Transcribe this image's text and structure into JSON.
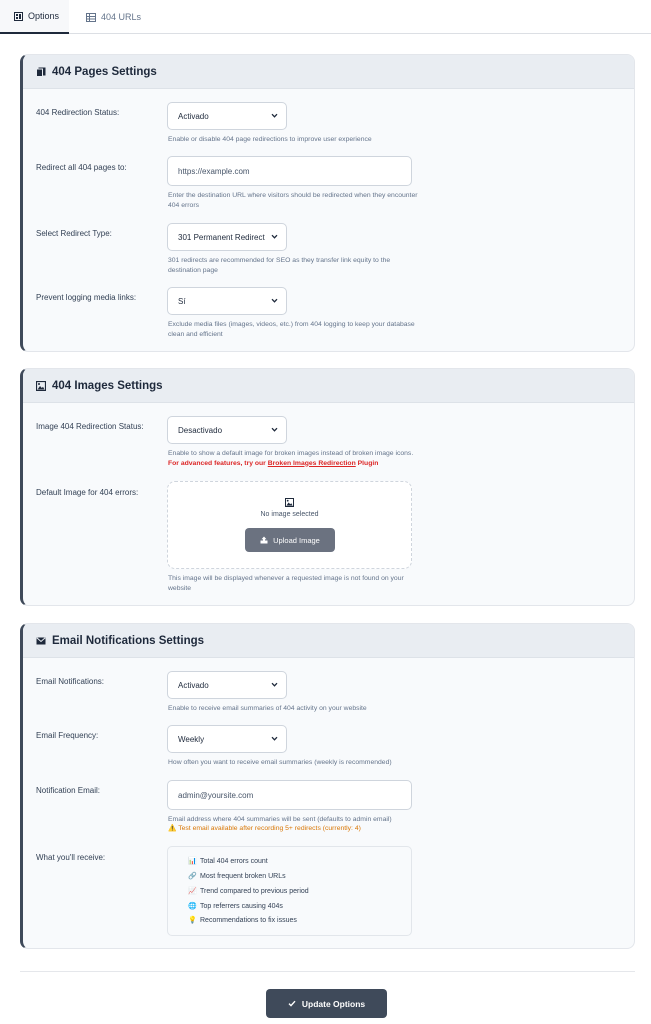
{
  "tabs": [
    {
      "label": "Options",
      "icon": "grid-icon",
      "active": true
    },
    {
      "label": "404 URLs",
      "icon": "table-icon",
      "active": false
    }
  ],
  "pages_section": {
    "title": "404 Pages Settings",
    "icon": "document-icon",
    "redirection_status": {
      "label": "404 Redirection Status:",
      "value": "Activado",
      "help": "Enable or disable 404 page redirections to improve user experience"
    },
    "redirect_to": {
      "label": "Redirect all 404 pages to:",
      "placeholder": "https://example.com",
      "help": "Enter the destination URL where visitors should be redirected when they encounter 404 errors"
    },
    "redirect_type": {
      "label": "Select Redirect Type:",
      "value": "301 Permanent Redirect",
      "help": "301 redirects are recommended for SEO as they transfer link equity to the destination page"
    },
    "prevent_logging": {
      "label": "Prevent logging media links:",
      "value": "Sí",
      "help": "Exclude media files (images, videos, etc.) from 404 logging to keep your database clean and efficient"
    }
  },
  "images_section": {
    "title": "404 Images Settings",
    "icon": "image-icon",
    "image_status": {
      "label": "Image 404 Redirection Status:",
      "value": "Desactivado",
      "help_plain": "Enable to show a default image for broken images instead of broken image icons. ",
      "help_red": "For advanced features, try our ",
      "help_link": "Broken Images Redirection",
      "help_tail": " Plugin"
    },
    "default_image": {
      "label": "Default Image for 404 errors:",
      "empty_text": "No image selected",
      "upload_label": "Upload Image",
      "help": "This image will be displayed whenever a requested image is not found on your website"
    }
  },
  "email_section": {
    "title": "Email Notifications Settings",
    "icon": "envelope-icon",
    "notifications": {
      "label": "Email Notifications:",
      "value": "Activado",
      "help": "Enable to receive email summaries of 404 activity on your website"
    },
    "frequency": {
      "label": "Email Frequency:",
      "value": "Weekly",
      "help": "How often you want to receive email summaries (weekly is recommended)"
    },
    "notification_email": {
      "label": "Notification Email:",
      "value": "admin@yoursite.com",
      "help": "Email address where 404 summaries will be sent (defaults to admin email)",
      "warning": "⚠️ Test email available after recording 5+ redirects (currently: 4)"
    },
    "receive": {
      "label": "What you'll receive:",
      "items": [
        {
          "icon": "📊",
          "text": "Total 404 errors count"
        },
        {
          "icon": "🔗",
          "text": "Most frequent broken URLs"
        },
        {
          "icon": "📈",
          "text": "Trend compared to previous period"
        },
        {
          "icon": "🌐",
          "text": "Top referrers causing 404s"
        },
        {
          "icon": "💡",
          "text": "Recommendations to fix issues"
        }
      ]
    }
  },
  "footer": {
    "update_label": "Update Options"
  }
}
